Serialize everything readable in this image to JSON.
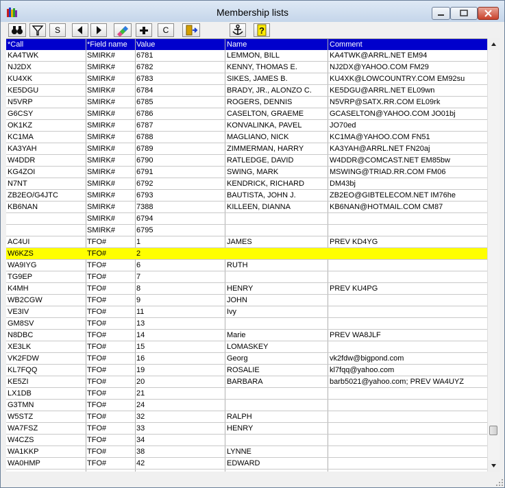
{
  "window": {
    "title": "Membership lists"
  },
  "toolbar": {
    "buttons": [
      {
        "name": "find-button",
        "label": "",
        "icon": "binoculars-icon"
      },
      {
        "name": "filter-button",
        "label": "",
        "icon": "filter-icon"
      },
      {
        "name": "s-button",
        "label": "S"
      },
      {
        "name": "previous-button",
        "label": "",
        "icon": "triangle-left-icon"
      },
      {
        "name": "next-button",
        "label": "",
        "icon": "triangle-right-icon"
      },
      {
        "name": "edit-button",
        "label": "",
        "icon": "pencil-eraser-icon"
      },
      {
        "name": "add-button",
        "label": "",
        "icon": "plus-icon"
      },
      {
        "name": "c-button",
        "label": "C"
      },
      {
        "name": "exit-button",
        "label": "",
        "icon": "door-exit-icon"
      },
      {
        "name": "anchor-button",
        "label": "",
        "icon": "anchor-icon"
      },
      {
        "name": "help-button",
        "label": "",
        "icon": "question-icon"
      }
    ]
  },
  "grid": {
    "columns": [
      "*Call",
      "*Field name",
      "Value",
      "Name",
      "Comment"
    ],
    "highlight_row": 17,
    "rows": [
      [
        "KA4TWK",
        "SMIRK#",
        "6781",
        "LEMMON, BILL",
        "KA4TWK@ARRL.NET EM94"
      ],
      [
        "NJ2DX",
        "SMIRK#",
        "6782",
        "KENNY, THOMAS E.",
        "NJ2DX@YAHOO.COM FM29"
      ],
      [
        "KU4XK",
        "SMIRK#",
        "6783",
        "SIKES, JAMES B.",
        "KU4XK@LOWCOUNTRY.COM EM92su"
      ],
      [
        "KE5DGU",
        "SMIRK#",
        "6784",
        "BRADY, JR., ALONZO C.",
        "KE5DGU@ARRL.NET EL09wn"
      ],
      [
        "N5VRP",
        "SMIRK#",
        "6785",
        "ROGERS, DENNIS",
        "N5VRP@SATX.RR.COM EL09rk"
      ],
      [
        "G6CSY",
        "SMIRK#",
        "6786",
        "CASELTON, GRAEME",
        "GCASELTON@YAHOO.COM JO01bj"
      ],
      [
        "OK1KZ",
        "SMIRK#",
        "6787",
        "KONVALINKA, PAVEL",
        "JO70ed"
      ],
      [
        "KC1MA",
        "SMIRK#",
        "6788",
        "MAGLIANO, NICK",
        "KC1MA@YAHOO.COM FN51"
      ],
      [
        "KA3YAH",
        "SMIRK#",
        "6789",
        "ZIMMERMAN, HARRY",
        "KA3YAH@ARRL.NET FN20aj"
      ],
      [
        "W4DDR",
        "SMIRK#",
        "6790",
        "RATLEDGE, DAVID",
        "W4DDR@COMCAST.NET EM85bw"
      ],
      [
        "KG4ZOI",
        "SMIRK#",
        "6791",
        "SWING, MARK",
        "MSWING@TRIAD.RR.COM FM06"
      ],
      [
        "N7NT",
        "SMIRK#",
        "6792",
        "KENDRICK, RICHARD",
        "DM43bj"
      ],
      [
        "ZB2EO/G4JTC",
        "SMIRK#",
        "6793",
        "BAUTISTA, JOHN J.",
        "ZB2EO@GIBTELECOM.NET IM76he"
      ],
      [
        "KB6NAN",
        "SMIRK#",
        "7388",
        "KILLEEN, DIANNA",
        "KB6NAN@HOTMAIL.COM CM87"
      ],
      [
        "",
        "SMIRK#",
        "6794",
        "",
        ""
      ],
      [
        "",
        "SMIRK#",
        "6795",
        "",
        ""
      ],
      [
        "AC4UI",
        "TFO#",
        "1",
        "JAMES",
        "PREV KD4YG"
      ],
      [
        "W6KZS",
        "TFO#",
        "2",
        "",
        ""
      ],
      [
        "WA9IYG",
        "TFO#",
        "6",
        "RUTH",
        ""
      ],
      [
        "TG9EP",
        "TFO#",
        "7",
        "",
        ""
      ],
      [
        "K4MH",
        "TFO#",
        "8",
        "HENRY",
        "PREV KU4PG"
      ],
      [
        "WB2CGW",
        "TFO#",
        "9",
        "JOHN",
        ""
      ],
      [
        "VE3IV",
        "TFO#",
        "11",
        "Ivy",
        ""
      ],
      [
        "GM8SV",
        "TFO#",
        "13",
        "",
        ""
      ],
      [
        "N8DBC",
        "TFO#",
        "14",
        "Marie",
        "PREV WA8JLF"
      ],
      [
        "XE3LK",
        "TFO#",
        "15",
        "LOMASKEY",
        ""
      ],
      [
        "VK2FDW",
        "TFO#",
        "16",
        "Georg",
        "vk2fdw@bigpond.com"
      ],
      [
        "KL7FQQ",
        "TFO#",
        "19",
        "ROSALIE",
        "kl7fqq@yahoo.com"
      ],
      [
        "KE5ZI",
        "TFO#",
        "20",
        "BARBARA",
        "barb5021@yahoo.com; PREV WA4UYZ"
      ],
      [
        "LX1DB",
        "TFO#",
        "21",
        "",
        ""
      ],
      [
        "G3TMN",
        "TFO#",
        "24",
        "",
        ""
      ],
      [
        "W5STZ",
        "TFO#",
        "32",
        "RALPH",
        ""
      ],
      [
        "WA7FSZ",
        "TFO#",
        "33",
        "HENRY",
        ""
      ],
      [
        "W4CZS",
        "TFO#",
        "34",
        "",
        ""
      ],
      [
        "WA1KKP",
        "TFO#",
        "38",
        "LYNNE",
        ""
      ],
      [
        "WA0HMP",
        "TFO#",
        "42",
        "EDWARD",
        ""
      ]
    ]
  }
}
